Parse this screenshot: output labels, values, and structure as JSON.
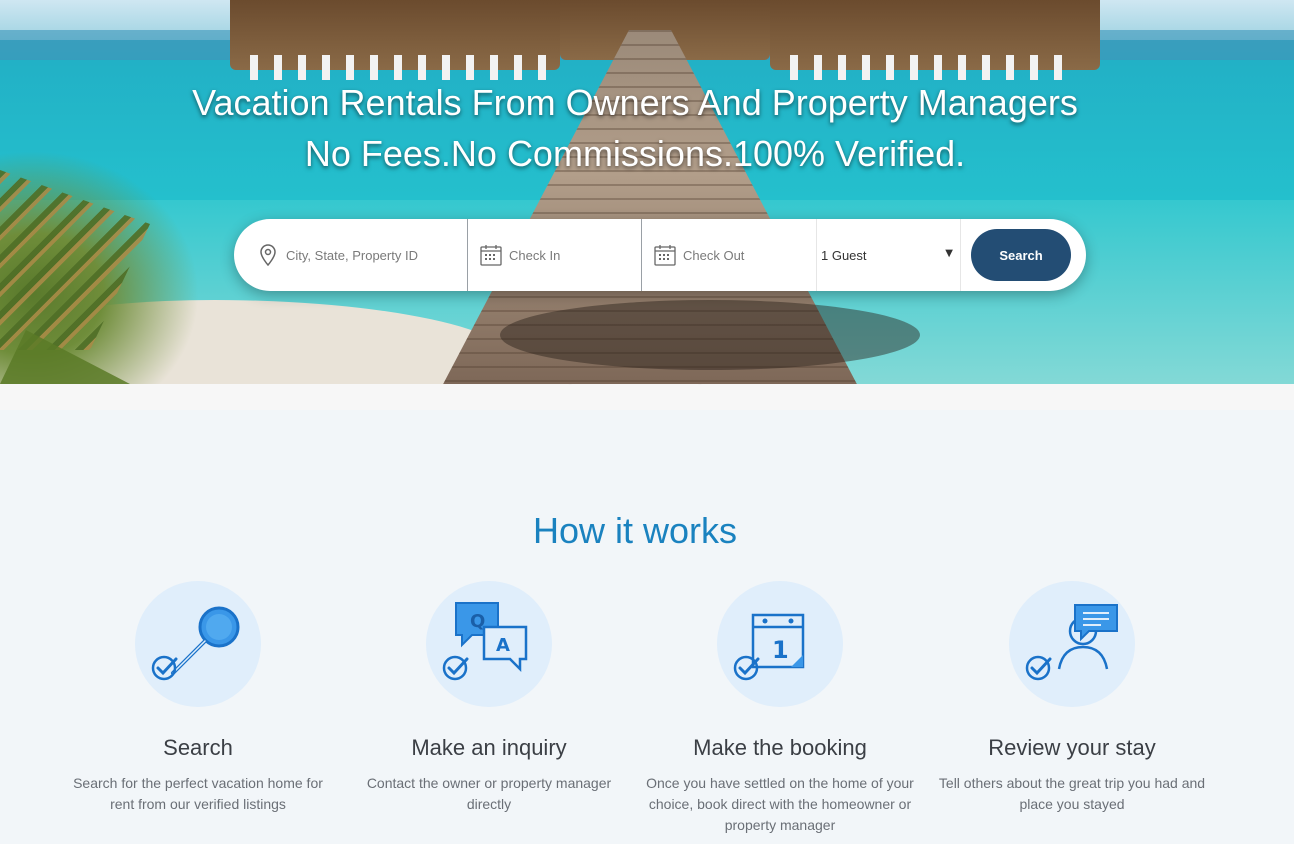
{
  "hero": {
    "title_line1": "Vacation Rentals From Owners And Property Managers",
    "title_line2": "No Fees.No Commissions.100% Verified."
  },
  "search": {
    "location_placeholder": "City, State, Property ID",
    "checkin_placeholder": "Check In",
    "checkout_placeholder": "Check Out",
    "guests_value": "1 Guest",
    "button_label": "Search",
    "button_color": "#234d74"
  },
  "how_it_works": {
    "title": "How it works",
    "title_color": "#1a82bf",
    "steps": [
      {
        "icon": "magnifier-check-icon",
        "title": "Search",
        "description": "Search for the perfect vacation home for rent from our verified listings"
      },
      {
        "icon": "qa-chat-check-icon",
        "title": "Make an inquiry",
        "description": "Contact the owner or property manager directly"
      },
      {
        "icon": "calendar-check-icon",
        "title": "Make the booking",
        "description": "Once you have settled on the home of your choice, book direct with the homeowner or property manager"
      },
      {
        "icon": "user-review-check-icon",
        "title": "Review your stay",
        "description": "Tell others about the great trip you had and place you stayed"
      }
    ]
  }
}
